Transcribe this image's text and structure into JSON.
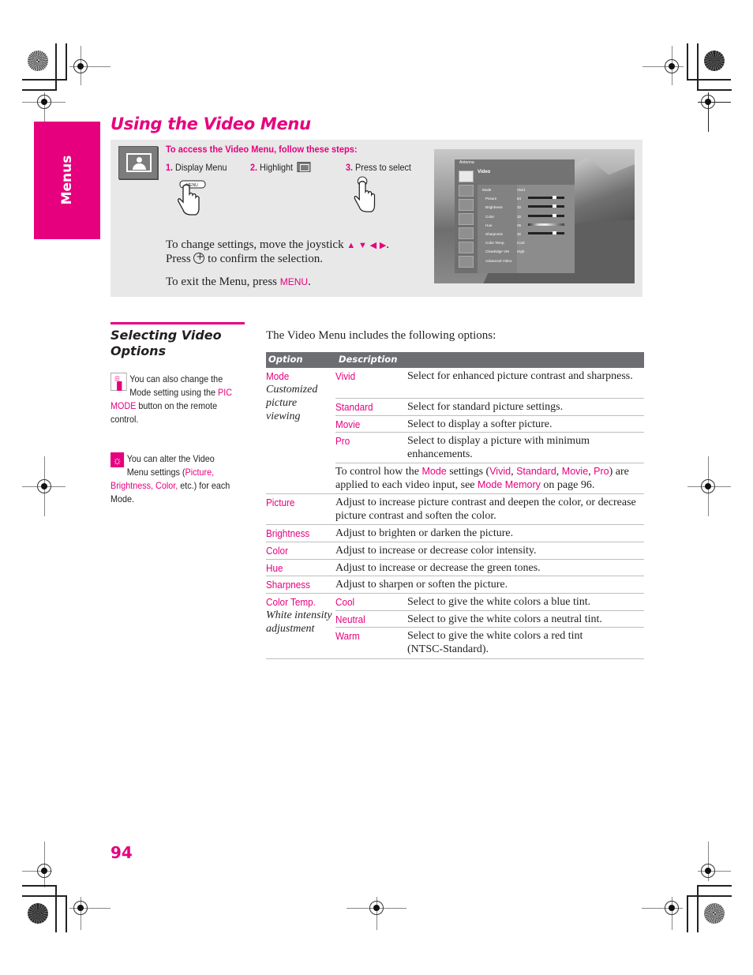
{
  "side_tab": {
    "label": "Menus"
  },
  "page_title": "Using the Video Menu",
  "access_box": {
    "heading": "To access the Video Menu, follow these steps:",
    "steps": [
      {
        "num": "1.",
        "text": "Display Menu",
        "button_label": "MENU"
      },
      {
        "num": "2.",
        "text": "Highlight"
      },
      {
        "num": "3.",
        "text": "Press to select"
      }
    ],
    "change_settings_line1": "To change settings, move the joystick",
    "arrows": [
      "▲",
      "▼",
      "◀",
      "▶"
    ],
    "change_settings_line2_pre": "Press",
    "change_settings_line2_post": "to confirm the selection.",
    "exit_pre": "To exit the Menu, press",
    "exit_button": "MENU",
    "exit_post": "."
  },
  "tv_menu": {
    "source": "Antenna",
    "section": "Video",
    "rows": [
      {
        "name": "Mode",
        "value": "Vivid"
      },
      {
        "name": "Picture",
        "value": "64",
        "level": 0.72
      },
      {
        "name": "Brightness",
        "value": "32",
        "level": 0.72
      },
      {
        "name": "Color",
        "value": "32",
        "level": 0.72
      },
      {
        "name": "Hue",
        "value": "25",
        "level": 0.25
      },
      {
        "name": "Sharpness",
        "value": "32",
        "level": 0.72
      },
      {
        "name": "Color Temp.",
        "value": "Cool"
      },
      {
        "name": "ClearEdge VM",
        "value": "High"
      },
      {
        "name": "Advanced Video",
        "value": ""
      }
    ]
  },
  "section": {
    "title_line1": "Selecting Video",
    "title_line2": "Options",
    "note1": {
      "icon": "remote-control-icon",
      "text_pre": "You can also change the Mode setting using the",
      "highlight": "PIC MODE",
      "text_post": "button on the remote control."
    },
    "note2": {
      "icon": "tip-lightbulb-icon",
      "text_pre": "You can alter the Video Menu settings (",
      "highlight": "Picture, Brightness, Color,",
      "text_post": "etc.) for each Mode."
    },
    "intro": "The Video Menu includes the following options:"
  },
  "table": {
    "headers": [
      "Option",
      "Description"
    ],
    "mode": {
      "option": "Mode",
      "subtitle": "Customized picture viewing",
      "choices": [
        {
          "name": "Vivid",
          "desc": "Select for enhanced picture contrast and sharpness."
        },
        {
          "name": "Standard",
          "desc": "Select for standard picture settings."
        },
        {
          "name": "Movie",
          "desc": "Select to display a softer picture."
        },
        {
          "name": "Pro",
          "desc": "Select to display a picture with minimum enhancements."
        }
      ],
      "note": {
        "p1": "To control how the",
        "mode": "Mode",
        "p2": "settings (",
        "vivid": "Vivid",
        "standard": "Standard",
        "movie": "Movie",
        "pro": "Pro",
        "p3": ") are applied to each video input, see",
        "link": "Mode Memory",
        "p4": "on page 96."
      }
    },
    "simple_rows": [
      {
        "option": "Picture",
        "desc": "Adjust to increase picture contrast and deepen the color, or decrease picture contrast and soften the color."
      },
      {
        "option": "Brightness",
        "desc": "Adjust to brighten or darken the picture."
      },
      {
        "option": "Color",
        "desc": "Adjust to increase or decrease color intensity."
      },
      {
        "option": "Hue",
        "desc": "Adjust to increase or decrease the green tones."
      },
      {
        "option": "Sharpness",
        "desc": "Adjust to sharpen or soften the picture."
      }
    ],
    "color_temp": {
      "option": "Color Temp.",
      "subtitle": "White intensity adjustment",
      "choices": [
        {
          "name": "Cool",
          "desc": "Select to give the white colors a blue tint."
        },
        {
          "name": "Neutral",
          "desc": "Select to give the white colors a neutral tint."
        },
        {
          "name": "Warm",
          "desc": "Select to give the white colors a red tint (NTSC-Standard)."
        }
      ]
    }
  },
  "page_number": "94",
  "colors": {
    "accent": "#e6007e",
    "box_gray": "#e8e8e8",
    "header_gray": "#6d6e71"
  }
}
